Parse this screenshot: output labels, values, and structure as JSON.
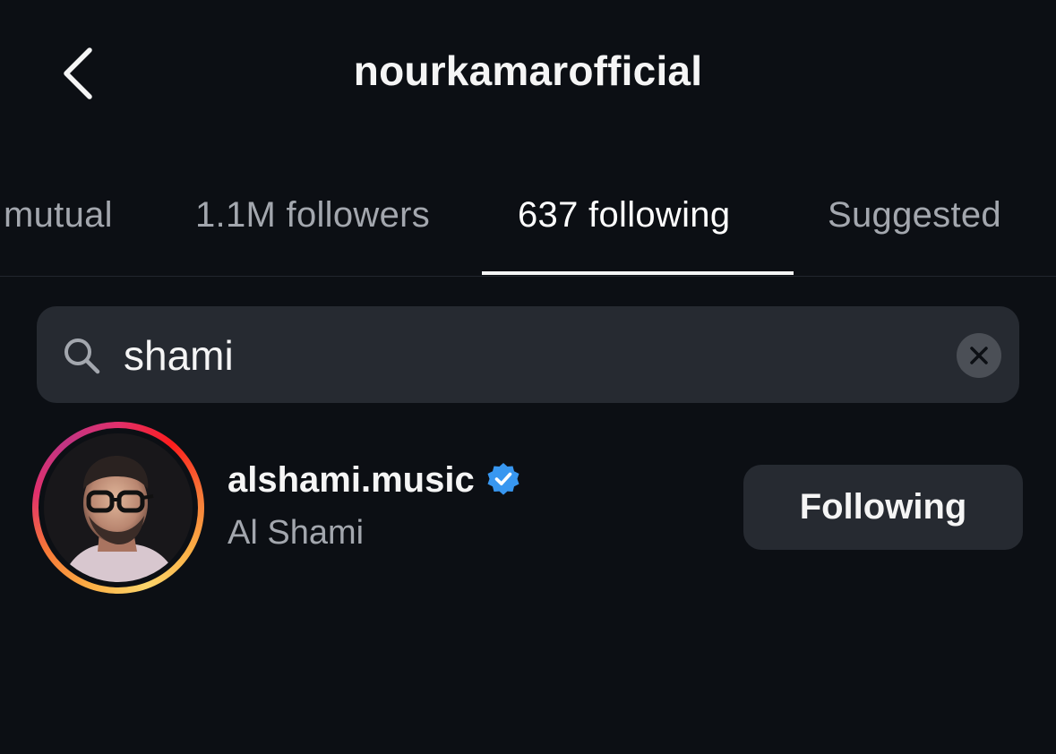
{
  "header": {
    "title": "nourkamarofficial",
    "back_icon": "chevron-left-icon"
  },
  "tabs": [
    {
      "label": "mutual",
      "active": false
    },
    {
      "label": "1.1M followers",
      "active": false
    },
    {
      "label": "637 following",
      "active": true
    },
    {
      "label": "Suggested",
      "active": false
    }
  ],
  "search": {
    "value": "shami",
    "icon": "search-icon",
    "clear_icon": "close-icon"
  },
  "results": [
    {
      "username": "alshami.music",
      "full_name": "Al Shami",
      "verified": true,
      "button_label": "Following"
    }
  ],
  "colors": {
    "background": "#0c0f14",
    "surface": "#262a31",
    "text_primary": "#f5f5f5",
    "text_secondary": "#a3a7ae",
    "verified_blue": "#3897f0"
  }
}
